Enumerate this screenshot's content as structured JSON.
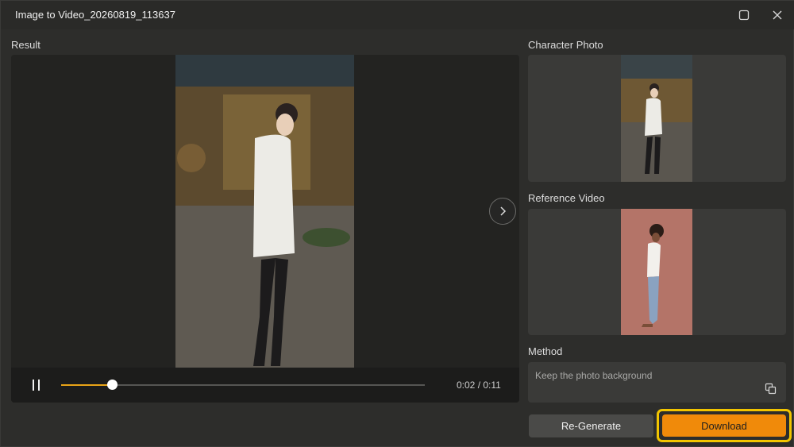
{
  "window": {
    "title": "Image to Video_20260819_113637",
    "maximize_icon": "maximize-icon",
    "close_icon": "close-icon"
  },
  "result": {
    "label": "Result",
    "next_icon": "chevron-right-icon",
    "player": {
      "pause_icon": "pause-icon",
      "progress_fraction": 0.14,
      "time": "0:02 / 0:11"
    }
  },
  "character_photo": {
    "label": "Character Photo"
  },
  "reference_video": {
    "label": "Reference Video"
  },
  "method": {
    "label": "Method",
    "text": "Keep the photo background",
    "copy_icon": "copy-icon"
  },
  "actions": {
    "regenerate_label": "Re-Generate",
    "download_label": "Download"
  },
  "colors": {
    "accent": "#f08a0a",
    "highlight": "#f2c500",
    "progress": "#e8a317",
    "background": "#2d2d2b"
  }
}
